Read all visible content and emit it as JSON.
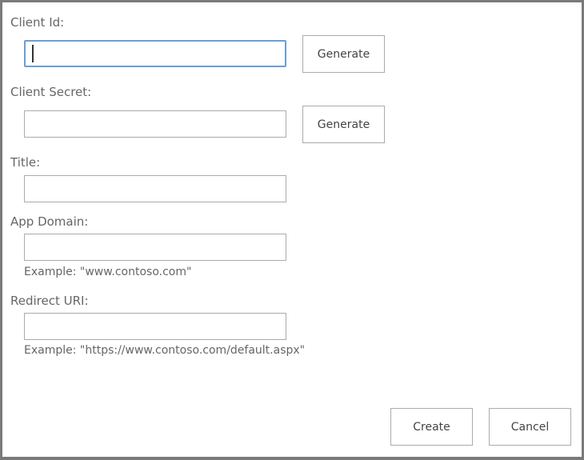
{
  "fields": {
    "client_id": {
      "label": "Client Id:",
      "value": ""
    },
    "client_secret": {
      "label": "Client Secret:",
      "value": ""
    },
    "title": {
      "label": "Title:",
      "value": ""
    },
    "app_domain": {
      "label": "App Domain:",
      "value": "",
      "example": "Example: \"www.contoso.com\""
    },
    "redirect_uri": {
      "label": "Redirect URI:",
      "value": "",
      "example": "Example: \"https://www.contoso.com/default.aspx\""
    }
  },
  "buttons": {
    "generate": "Generate",
    "create": "Create",
    "cancel": "Cancel"
  }
}
